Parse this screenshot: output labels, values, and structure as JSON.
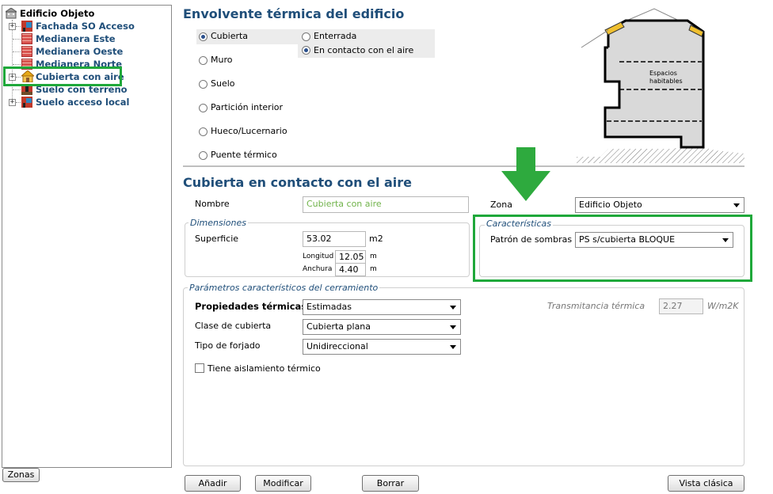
{
  "tree": {
    "root": "Edificio Objeto",
    "items": [
      {
        "label": "Fachada SO Acceso",
        "expandable": true
      },
      {
        "label": "Medianera Este",
        "expandable": false
      },
      {
        "label": "Medianera Oeste",
        "expandable": false
      },
      {
        "label": "Medianera Norte",
        "expandable": false
      },
      {
        "label": "Cubierta con aire",
        "expandable": true
      },
      {
        "label": "Suelo con terreno",
        "expandable": false
      },
      {
        "label": "Suelo acceso local",
        "expandable": true
      }
    ],
    "zones_button": "Zonas"
  },
  "envelope": {
    "title": "Envolvente térmica del edificio",
    "types": [
      "Cubierta",
      "Muro",
      "Suelo",
      "Partición interior",
      "Hueco/Lucernario",
      "Puente térmico"
    ],
    "selected_type": "Cubierta",
    "subtypes": [
      "Enterrada",
      "En contacto con el aire"
    ],
    "selected_subtype": "En contacto con el aire",
    "diagram_label_1": "Espacios",
    "diagram_label_2": "habitables"
  },
  "detail": {
    "title": "Cubierta en contacto con el aire",
    "name_label": "Nombre",
    "name_value": "Cubierta con aire",
    "zone_label": "Zona",
    "zone_value": "Edificio Objeto",
    "dimensions": {
      "legend": "Dimensiones",
      "surface_label": "Superficie",
      "surface_value": "53.02",
      "surface_unit": "m2",
      "length_label": "Longitud",
      "length_value": "12.05",
      "length_unit": "m",
      "width_label": "Anchura",
      "width_value": "4.40",
      "width_unit": "m"
    },
    "characteristics": {
      "legend": "Características",
      "shadow_label": "Patrón de sombras",
      "shadow_value": "PS s/cubierta BLOQUE"
    },
    "params": {
      "legend": "Parámetros característicos del cerramiento",
      "thermal_label": "Propiedades térmicas",
      "thermal_value": "Estimadas",
      "roof_class_label": "Clase de cubierta",
      "roof_class_value": "Cubierta plana",
      "slab_label": "Tipo de forjado",
      "slab_value": "Unidireccional",
      "insulation_label": "Tiene aislamiento térmico",
      "transmittance_label": "Transmitancia térmica",
      "transmittance_value": "2.27",
      "transmittance_unit": "W/m2K"
    }
  },
  "buttons": {
    "add": "Añadir",
    "modify": "Modificar",
    "delete": "Borrar",
    "classic": "Vista clásica"
  },
  "colors": {
    "highlight_green": "#1fa83a",
    "arrow_green": "#2eaa3e",
    "title_blue": "#1f4e79"
  }
}
